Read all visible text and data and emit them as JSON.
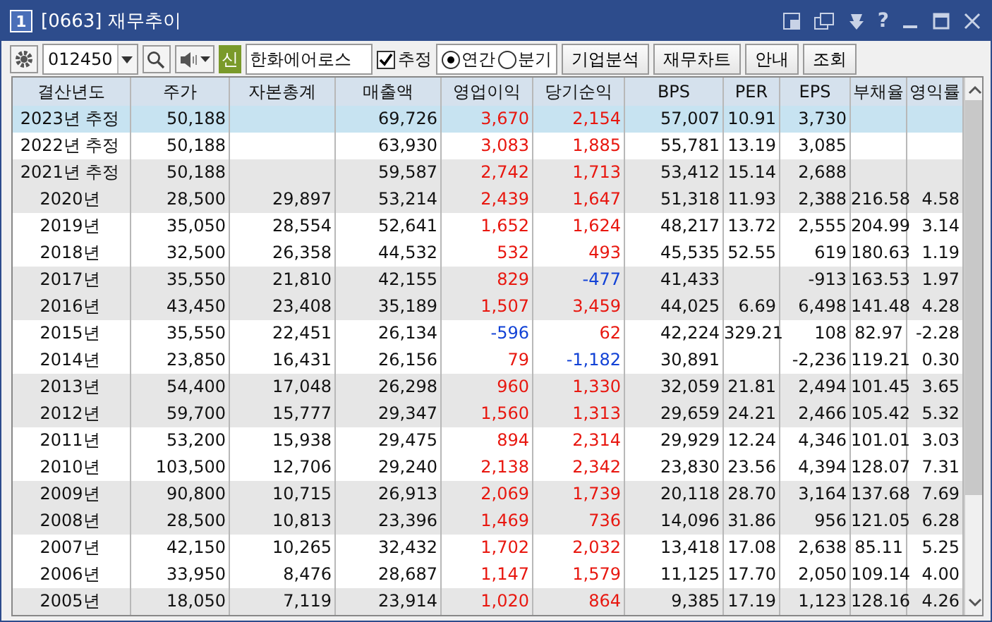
{
  "window": {
    "badge": "1",
    "title": "[0663]  재무추이",
    "help": "?"
  },
  "toolbar": {
    "code": "012450",
    "market_badge": "신",
    "company": "한화에어로스",
    "estimate": {
      "label": "추정",
      "checked": true
    },
    "period": [
      {
        "label": "연간",
        "selected": true
      },
      {
        "label": "분기",
        "selected": false
      }
    ],
    "buttons": [
      "기업분석",
      "재무차트",
      "안내",
      "조회"
    ]
  },
  "table": {
    "columns": [
      "결산년도",
      "주가",
      "자본총계",
      "매출액",
      "영업이익",
      "당기순익",
      "BPS",
      "PER",
      "EPS",
      "부채율",
      "영익률"
    ],
    "rows": [
      {
        "selected": true,
        "cells": [
          "2023년 추정",
          "50,188",
          "",
          "69,726",
          {
            "text": "3,670",
            "negative": false
          },
          {
            "text": "2,154",
            "negative": false
          },
          "57,007",
          "10.91",
          "3,730",
          "",
          ""
        ]
      },
      {
        "selected": false,
        "cells": [
          "2022년 추정",
          "50,188",
          "",
          "63,930",
          {
            "text": "3,083",
            "negative": false
          },
          {
            "text": "1,885",
            "negative": false
          },
          "55,781",
          "13.19",
          "3,085",
          "",
          ""
        ]
      },
      {
        "selected": false,
        "cells": [
          "2021년 추정",
          "50,188",
          "",
          "59,587",
          {
            "text": "2,742",
            "negative": false
          },
          {
            "text": "1,713",
            "negative": false
          },
          "53,412",
          "15.14",
          "2,688",
          "",
          ""
        ]
      },
      {
        "selected": false,
        "cells": [
          "2020년",
          "28,500",
          "29,897",
          "53,214",
          {
            "text": "2,439",
            "negative": false
          },
          {
            "text": "1,647",
            "negative": false
          },
          "51,318",
          "11.93",
          "2,388",
          "216.58",
          "4.58"
        ]
      },
      {
        "selected": false,
        "cells": [
          "2019년",
          "35,050",
          "28,554",
          "52,641",
          {
            "text": "1,652",
            "negative": false
          },
          {
            "text": "1,624",
            "negative": false
          },
          "48,217",
          "13.72",
          "2,555",
          "204.99",
          "3.14"
        ]
      },
      {
        "selected": false,
        "cells": [
          "2018년",
          "32,500",
          "26,358",
          "44,532",
          {
            "text": "532",
            "negative": false
          },
          {
            "text": "493",
            "negative": false
          },
          "45,535",
          "52.55",
          "619",
          "180.63",
          "1.19"
        ]
      },
      {
        "selected": false,
        "cells": [
          "2017년",
          "35,550",
          "21,810",
          "42,155",
          {
            "text": "829",
            "negative": false
          },
          {
            "text": "-477",
            "negative": true
          },
          "41,433",
          "",
          "-913",
          "163.53",
          "1.97"
        ]
      },
      {
        "selected": false,
        "cells": [
          "2016년",
          "43,450",
          "23,408",
          "35,189",
          {
            "text": "1,507",
            "negative": false
          },
          {
            "text": "3,459",
            "negative": false
          },
          "44,025",
          "6.69",
          "6,498",
          "141.48",
          "4.28"
        ]
      },
      {
        "selected": false,
        "cells": [
          "2015년",
          "35,550",
          "22,451",
          "26,134",
          {
            "text": "-596",
            "negative": true
          },
          {
            "text": "62",
            "negative": false
          },
          "42,224",
          "329.21",
          "108",
          "82.97",
          "-2.28"
        ]
      },
      {
        "selected": false,
        "cells": [
          "2014년",
          "23,850",
          "16,431",
          "26,156",
          {
            "text": "79",
            "negative": false
          },
          {
            "text": "-1,182",
            "negative": true
          },
          "30,891",
          "",
          "-2,236",
          "119.21",
          "0.30"
        ]
      },
      {
        "selected": false,
        "cells": [
          "2013년",
          "54,400",
          "17,048",
          "26,298",
          {
            "text": "960",
            "negative": false
          },
          {
            "text": "1,330",
            "negative": false
          },
          "32,059",
          "21.81",
          "2,494",
          "101.45",
          "3.65"
        ]
      },
      {
        "selected": false,
        "cells": [
          "2012년",
          "59,700",
          "15,777",
          "29,347",
          {
            "text": "1,560",
            "negative": false
          },
          {
            "text": "1,313",
            "negative": false
          },
          "29,659",
          "24.21",
          "2,466",
          "105.42",
          "5.32"
        ]
      },
      {
        "selected": false,
        "cells": [
          "2011년",
          "53,200",
          "15,938",
          "29,475",
          {
            "text": "894",
            "negative": false
          },
          {
            "text": "2,314",
            "negative": false
          },
          "29,929",
          "12.24",
          "4,346",
          "101.01",
          "3.03"
        ]
      },
      {
        "selected": false,
        "cells": [
          "2010년",
          "103,500",
          "12,706",
          "29,240",
          {
            "text": "2,138",
            "negative": false
          },
          {
            "text": "2,342",
            "negative": false
          },
          "23,830",
          "23.56",
          "4,394",
          "128.07",
          "7.31"
        ]
      },
      {
        "selected": false,
        "cells": [
          "2009년",
          "90,800",
          "10,715",
          "26,913",
          {
            "text": "2,069",
            "negative": false
          },
          {
            "text": "1,739",
            "negative": false
          },
          "20,118",
          "28.70",
          "3,164",
          "137.68",
          "7.69"
        ]
      },
      {
        "selected": false,
        "cells": [
          "2008년",
          "28,500",
          "10,813",
          "23,396",
          {
            "text": "1,469",
            "negative": false
          },
          {
            "text": "736",
            "negative": false
          },
          "14,096",
          "31.86",
          "956",
          "121.05",
          "6.28"
        ]
      },
      {
        "selected": false,
        "cells": [
          "2007년",
          "42,150",
          "10,265",
          "32,432",
          {
            "text": "1,702",
            "negative": false
          },
          {
            "text": "2,032",
            "negative": false
          },
          "13,418",
          "17.08",
          "2,638",
          "85.11",
          "5.25"
        ]
      },
      {
        "selected": false,
        "cells": [
          "2006년",
          "33,950",
          "8,476",
          "28,687",
          {
            "text": "1,147",
            "negative": false
          },
          {
            "text": "1,579",
            "negative": false
          },
          "11,125",
          "17.70",
          "2,050",
          "109.14",
          "4.00"
        ]
      },
      {
        "selected": false,
        "cells": [
          "2005년",
          "18,050",
          "7,119",
          "23,914",
          {
            "text": "1,020",
            "negative": false
          },
          {
            "text": "864",
            "negative": false
          },
          "9,385",
          "17.19",
          "1,123",
          "128.16",
          "4.26"
        ]
      }
    ]
  }
}
